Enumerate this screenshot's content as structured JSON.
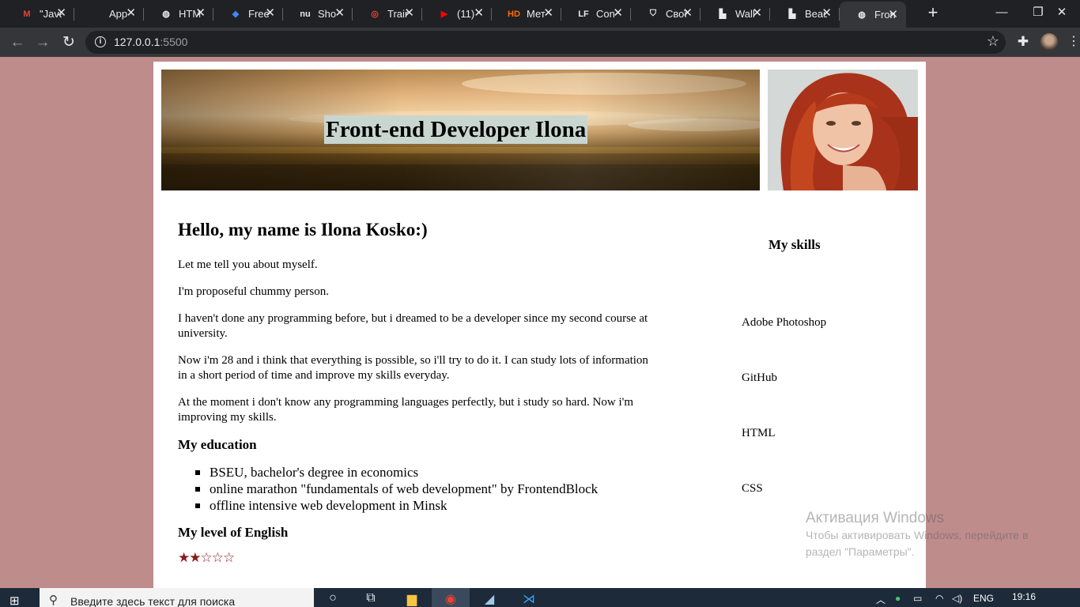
{
  "browser": {
    "tabs": [
      {
        "label": "\"Java",
        "icon": "gmail-icon",
        "icon_glyph": "M",
        "icon_color": "#ea4335"
      },
      {
        "label": "App",
        "icon": "apps-icon",
        "icon_glyph": "",
        "icon_color": "#5f6368"
      },
      {
        "label": "HTM",
        "icon": "globe-icon",
        "icon_glyph": "◍",
        "icon_color": "#e8eaed"
      },
      {
        "label": "Free",
        "icon": "shield-icon",
        "icon_glyph": "◆",
        "icon_color": "#4285f4"
      },
      {
        "label": "Sho",
        "icon": "nu-icon",
        "icon_glyph": "nu",
        "icon_color": "#e8eaed"
      },
      {
        "label": "Trair",
        "icon": "trainer-icon",
        "icon_glyph": "◎",
        "icon_color": "#ea4335"
      },
      {
        "label": "(11)",
        "icon": "youtube-icon",
        "icon_glyph": "▶",
        "icon_color": "#ff0000"
      },
      {
        "label": "Мет",
        "icon": "hd-icon",
        "icon_glyph": "HD",
        "icon_color": "#ff6d00"
      },
      {
        "label": "Con",
        "icon": "lf-icon",
        "icon_glyph": "LF",
        "icon_color": "#e8eaed"
      },
      {
        "label": "Свої",
        "icon": "shield-outline-icon",
        "icon_glyph": "⛉",
        "icon_color": "#e8eaed"
      },
      {
        "label": "Wall",
        "icon": "wallpaper-icon",
        "icon_glyph": "▙",
        "icon_color": "#e8eaed"
      },
      {
        "label": "Beau",
        "icon": "wallpaper-icon",
        "icon_glyph": "▙",
        "icon_color": "#e8eaed"
      },
      {
        "label": "Fron",
        "icon": "globe-icon",
        "icon_glyph": "◍",
        "icon_color": "#e8eaed",
        "active": true
      }
    ],
    "new_tab": "+",
    "window_controls": {
      "minimize": "—",
      "restore": "❐",
      "close": "✕"
    },
    "url": "127.0.0.1",
    "url_port": ":5500"
  },
  "page": {
    "banner_title": "Front-end Developer Ilona",
    "hello": "Hello, my name is Ilona Kosko:)",
    "paragraphs": [
      "Let me tell you about myself.",
      "I'm proposeful chummy person.",
      "I haven't done any programming before, but i dreamed to be a developer since my second course at university.",
      "Now i'm 28 and i think that everything is possible, so i'll try to do it. I can study lots of information in a short period of time and improve my skills everyday.",
      "At the moment i don't know any programming languages perfectly, but i study so hard. Now i'm improving my skills."
    ],
    "education_title": "My education",
    "education": [
      "BSEU, bachelor's degree in economics",
      "online marathon \"fundamentals of web development\" by FrontendBlock",
      "offline intensive web development in Minsk"
    ],
    "english_title": "My level of English",
    "english_rating": {
      "filled": 2,
      "total": 5
    },
    "skills_title": "My skills",
    "skills": [
      "Adobe Photoshop",
      "GitHub",
      "HTML",
      "CSS"
    ]
  },
  "watermark": {
    "title": "Активация Windows",
    "text": "Чтобы активировать Windows, перейдите в раздел \"Параметры\"."
  },
  "taskbar": {
    "search_placeholder": "Введите здесь текст для поиска",
    "language": "ENG",
    "time": "19:16"
  }
}
